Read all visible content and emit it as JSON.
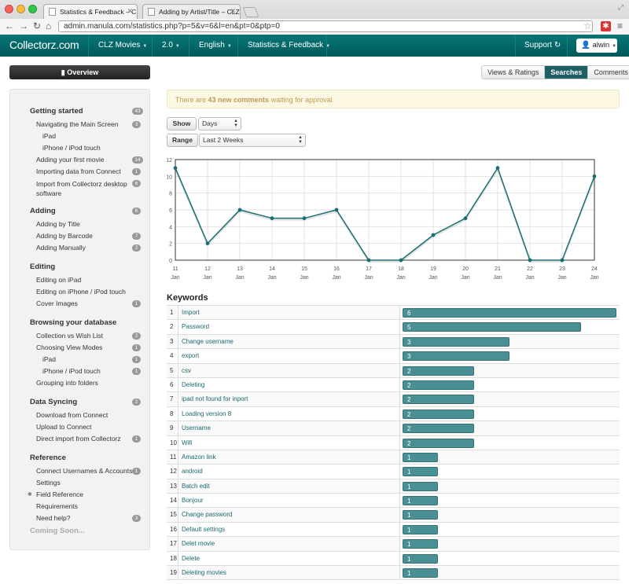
{
  "browser": {
    "tabs": [
      {
        "title": "Statistics & Feedback – CLZ"
      },
      {
        "title": "Adding by Artist/Title – CLZ"
      }
    ],
    "url": "admin.manula.com/statistics.php?p=5&v=6&l=en&pt=0&ptp=0",
    "icons": [
      "back-icon",
      "forward-icon",
      "reload-icon",
      "home-icon",
      "star-icon",
      "extension-icon",
      "wrench-icon"
    ]
  },
  "navbar": {
    "brand": "Collectorz.com",
    "items": [
      "CLZ Movies",
      "2.0",
      "English",
      "Statistics & Feedback"
    ],
    "support": "Support",
    "user": "alwin"
  },
  "overview_button": "Overview",
  "view_tabs": [
    "Views & Ratings",
    "Searches",
    "Comments"
  ],
  "active_view_tab": "Searches",
  "alert": {
    "prefix": "There are ",
    "count": "43 new comments",
    "suffix": " waiting for approval."
  },
  "controls": {
    "show_label": "Show",
    "show_value": "Days",
    "range_label": "Range",
    "range_value": "Last 2 Weeks"
  },
  "sidebar": {
    "sections": [
      {
        "title": "Getting started",
        "badge": "43",
        "items": [
          {
            "label": "Navigating the Main Screen",
            "badge": "3",
            "sub": false
          },
          {
            "label": "iPad",
            "badge": "",
            "sub": true
          },
          {
            "label": "iPhone / iPod touch",
            "badge": "",
            "sub": true
          },
          {
            "label": "Adding your first movie",
            "badge": "14",
            "sub": false
          },
          {
            "label": "Importing data from Connect",
            "badge": "1",
            "sub": false
          },
          {
            "label": "Import from Collectorz desktop software",
            "badge": "6",
            "sub": false
          }
        ]
      },
      {
        "title": "Adding",
        "badge": "6",
        "items": [
          {
            "label": "Adding by Title",
            "badge": "",
            "sub": false
          },
          {
            "label": "Adding by Barcode",
            "badge": "7",
            "sub": false
          },
          {
            "label": "Adding Manually",
            "badge": "2",
            "sub": false
          }
        ]
      },
      {
        "title": "Editing",
        "badge": "",
        "items": [
          {
            "label": "Editing on iPad",
            "badge": "",
            "sub": false
          },
          {
            "label": "Editing on iPhone / iPod touch",
            "badge": "",
            "sub": false
          },
          {
            "label": "Cover Images",
            "badge": "1",
            "sub": false
          }
        ]
      },
      {
        "title": "Browsing your database",
        "badge": "",
        "items": [
          {
            "label": "Collection vs Wish List",
            "badge": "2",
            "sub": false
          },
          {
            "label": "Choosing View Modes",
            "badge": "1",
            "sub": false
          },
          {
            "label": "iPad",
            "badge": "1",
            "sub": true
          },
          {
            "label": "iPhone / iPod touch",
            "badge": "1",
            "sub": true
          },
          {
            "label": "Grouping into folders",
            "badge": "",
            "sub": false
          }
        ]
      },
      {
        "title": "Data Syncing",
        "badge": "2",
        "items": [
          {
            "label": "Download from Connect",
            "badge": "",
            "sub": false
          },
          {
            "label": "Upload to Connect",
            "badge": "",
            "sub": false
          },
          {
            "label": "Direct import from Collectorz",
            "badge": "1",
            "sub": false
          }
        ]
      },
      {
        "title": "Reference",
        "badge": "",
        "items": [
          {
            "label": "Connect Usernames & Accounts",
            "badge": "1",
            "sub": false
          },
          {
            "label": "Settings",
            "badge": "",
            "sub": false
          },
          {
            "label": "Field Reference",
            "badge": "",
            "sub": false
          },
          {
            "label": "Requirements",
            "badge": "",
            "sub": false
          },
          {
            "label": "Need help?",
            "badge": "3",
            "sub": false
          }
        ]
      }
    ],
    "coming_soon": "Coming Soon..."
  },
  "chart_data": {
    "type": "line",
    "x": [
      "11",
      "12",
      "13",
      "14",
      "15",
      "16",
      "17",
      "18",
      "19",
      "20",
      "21",
      "22",
      "23",
      "24"
    ],
    "x_sub": "Jan",
    "values": [
      11,
      2,
      6,
      5,
      5,
      6,
      0,
      0,
      3,
      5,
      11,
      0,
      0,
      10
    ],
    "ylim": [
      0,
      12
    ],
    "yticks": [
      0,
      2,
      4,
      6,
      8,
      10,
      12
    ],
    "grid": true,
    "color": "#1a6e72"
  },
  "keywords": {
    "title": "Keywords",
    "rows": [
      {
        "rank": "1",
        "keyword": "Import",
        "count": 6
      },
      {
        "rank": "2",
        "keyword": "Password",
        "count": 5
      },
      {
        "rank": "3",
        "keyword": "Change username",
        "count": 3
      },
      {
        "rank": "4",
        "keyword": "export",
        "count": 3
      },
      {
        "rank": "5",
        "keyword": "csv",
        "count": 2
      },
      {
        "rank": "6",
        "keyword": "Deleting",
        "count": 2
      },
      {
        "rank": "7",
        "keyword": "ipad not found for inport",
        "count": 2
      },
      {
        "rank": "8",
        "keyword": "Loading version 8",
        "count": 2
      },
      {
        "rank": "9",
        "keyword": "Username",
        "count": 2
      },
      {
        "rank": "10",
        "keyword": "Wifi",
        "count": 2
      },
      {
        "rank": "11",
        "keyword": "Amazon link",
        "count": 1
      },
      {
        "rank": "12",
        "keyword": "android",
        "count": 1
      },
      {
        "rank": "13",
        "keyword": "Batch edit",
        "count": 1
      },
      {
        "rank": "14",
        "keyword": "Bonjour",
        "count": 1
      },
      {
        "rank": "15",
        "keyword": "Change password",
        "count": 1
      },
      {
        "rank": "16",
        "keyword": "Default settings",
        "count": 1
      },
      {
        "rank": "17",
        "keyword": "Delet movie",
        "count": 1
      },
      {
        "rank": "18",
        "keyword": "Delete",
        "count": 1
      },
      {
        "rank": "19",
        "keyword": "Deleting movies",
        "count": 1
      }
    ]
  }
}
